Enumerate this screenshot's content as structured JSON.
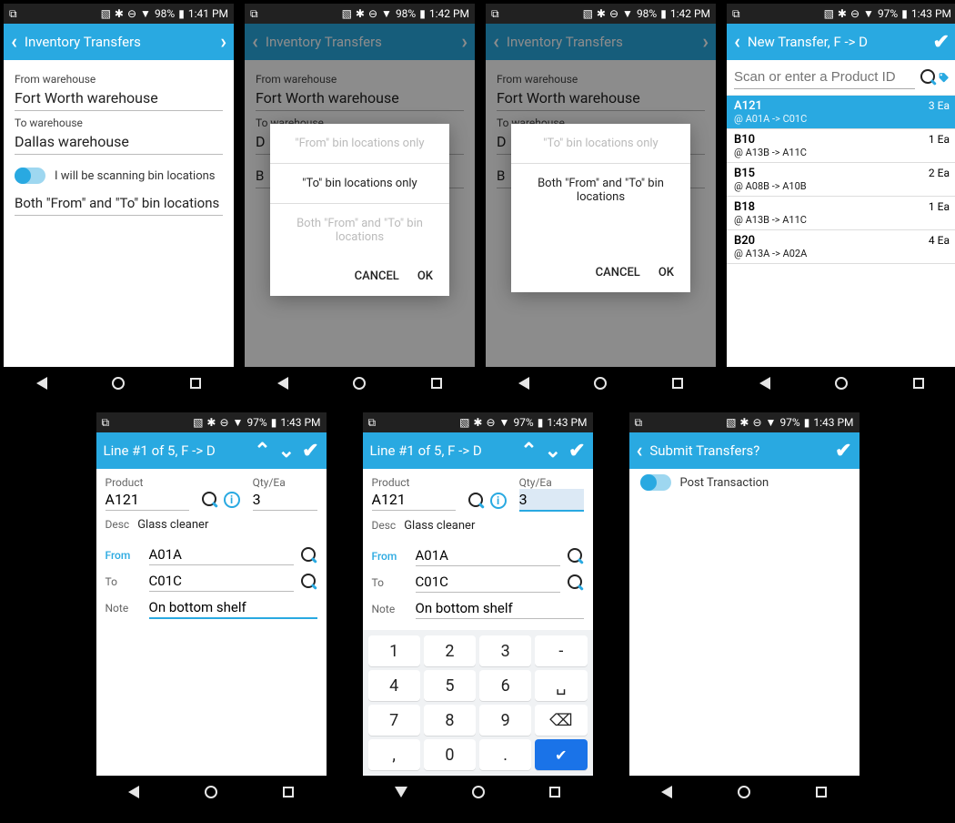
{
  "status": {
    "batt1": "98%",
    "time1": "1:41 PM",
    "time2": "1:42 PM",
    "batt2": "97%",
    "time3": "1:43 PM"
  },
  "screens": {
    "inv": {
      "title": "Inventory Transfers",
      "from_label": "From warehouse",
      "from_value": "Fort Worth warehouse",
      "to_label": "To warehouse",
      "to_value": "Dallas warehouse",
      "scan_label": "I will be scanning bin locations",
      "mode_value": "Both \"From\" and \"To\" bin locations"
    },
    "dialog": {
      "opt1": "\"From\" bin locations only",
      "opt2": "\"To\" bin locations only",
      "opt3": "Both \"From\" and \"To\" bin locations",
      "cancel": "CANCEL",
      "ok": "OK"
    },
    "newtransfer": {
      "title": "New Transfer, F -> D",
      "search_ph": "Scan or enter a Product ID",
      "items": [
        {
          "pid": "A121",
          "loc": "@ A01A -> C01C",
          "qty": "3 Ea",
          "sel": true
        },
        {
          "pid": "B10",
          "loc": "@ A13B -> A11C",
          "qty": "1 Ea"
        },
        {
          "pid": "B15",
          "loc": "@ A08B -> A10B",
          "qty": "2 Ea"
        },
        {
          "pid": "B18",
          "loc": "@ A13B -> A11C",
          "qty": "1 Ea"
        },
        {
          "pid": "B20",
          "loc": "@ A13A -> A02A",
          "qty": "4 Ea"
        }
      ]
    },
    "line": {
      "title": "Line #1 of 5, F -> D",
      "product_label": "Product",
      "qty_label": "Qty/Ea",
      "product": "A121",
      "qty": "3",
      "desc_label": "Desc",
      "desc": "Glass cleaner",
      "from_label": "From",
      "from": "A01A",
      "to_label": "To",
      "to": "C01C",
      "note_label": "Note",
      "note": "On bottom shelf"
    },
    "submit": {
      "title": "Submit Transfers?",
      "post": "Post Transaction"
    },
    "keypad": {
      "k1": "1",
      "k2": "2",
      "k3": "3",
      "km": "-",
      "k4": "4",
      "k5": "5",
      "k6": "6",
      "ksp": "␣",
      "k7": "7",
      "k8": "8",
      "k9": "9",
      "kc": ",",
      "k0": "0",
      "kd": "."
    }
  }
}
